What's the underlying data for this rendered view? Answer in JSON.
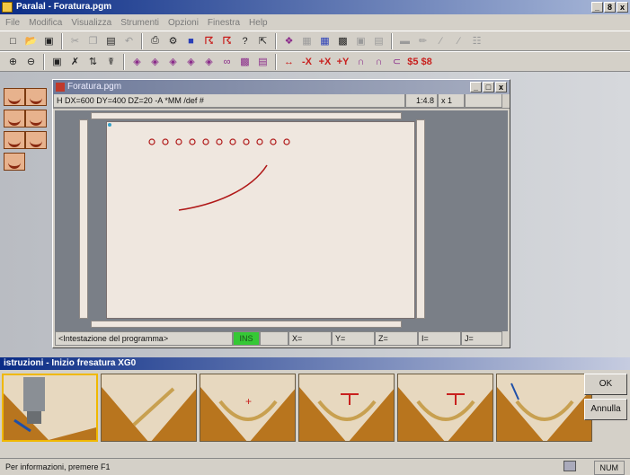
{
  "app": {
    "title": "Paralal - Foratura.pgm"
  },
  "window_controls": [
    "_",
    "8",
    "x"
  ],
  "menu": [
    "File",
    "Modifica",
    "Visualizza",
    "Strumenti",
    "Opzioni",
    "Finestra",
    "Help"
  ],
  "toolbar1_icons": [
    "new-icon",
    "open-icon",
    "save-icon",
    "cut-icon",
    "copy-icon",
    "paste-icon",
    "undo-icon",
    "print-icon",
    "settings-icon",
    "window-icon",
    "tool-icon",
    "tool2-icon",
    "help-icon",
    "help-pointer-icon",
    "tool3-icon",
    "grid-icon",
    "table-icon",
    "machine-icon",
    "doc-icon",
    "doc2-icon",
    "brush-icon",
    "pencil-icon",
    "line-icon",
    "line2-icon",
    "graph-icon"
  ],
  "toolbar2_icons": [
    "zoom-in-icon",
    "zoom-out-icon",
    "select-icon",
    "mirror-icon",
    "rotate-icon",
    "tool-icon",
    "draw1-icon",
    "draw2-icon",
    "draw3-icon",
    "draw4-icon",
    "draw5-icon",
    "spiral-icon",
    "hatch-icon",
    "align-icon",
    "arrow-x-icon",
    "arrow-x2-icon",
    "arrow-y-icon",
    "shape1-icon",
    "shape2-icon",
    "shape3-icon",
    "number-icon"
  ],
  "toolbar2_labels": {
    "x_minus": "-X",
    "x_plus": "+X",
    "y_plus": "+Y",
    "code": "$5 $8"
  },
  "child_window": {
    "title": "Foratura.pgm",
    "info_header": "H DX=600 DY=400 DZ=20 -A *MM /def #",
    "scale": "1:4.8",
    "multiplier": "x 1"
  },
  "status_row": {
    "program_header": "<Intestazione del programma>",
    "ins": "INS",
    "x": "X=",
    "y": "Y=",
    "z": "Z=",
    "i": "I=",
    "j": "J="
  },
  "panel": {
    "title": "istruzioni - Inizio fresatura XG0",
    "ok": "OK",
    "cancel": "Annulla"
  },
  "status_bar": {
    "help_text": "Per informazioni, premere F1",
    "num": "NUM"
  },
  "colors": {
    "accent": "#0a2c86",
    "tool_wood": "#b8751e",
    "tool_bg": "#e7d8bf",
    "curve": "#b01818"
  }
}
